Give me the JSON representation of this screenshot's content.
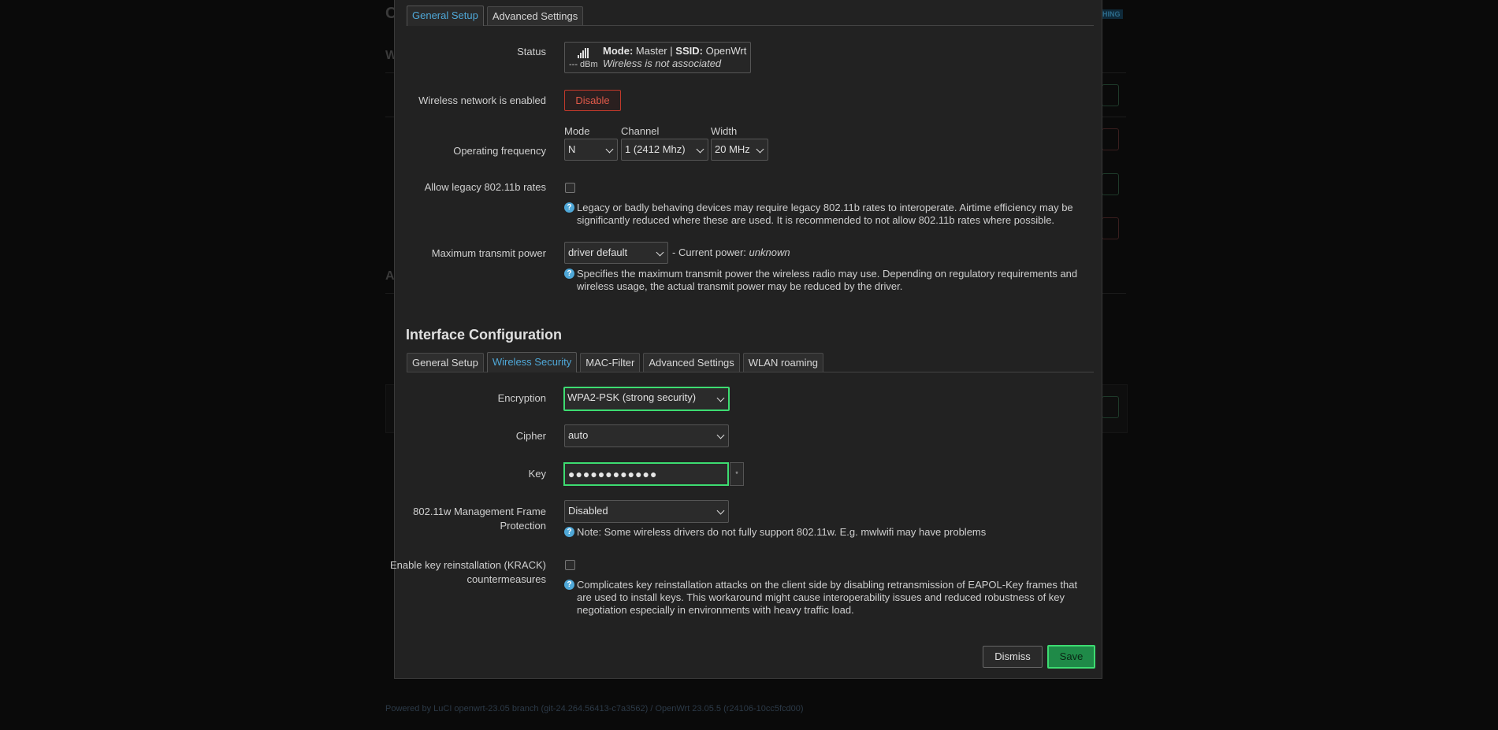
{
  "background": {
    "footer": "Powered by LuCI openwrt-23.05 branch (git-24.264.56413-c7a3562) / OpenWrt 23.05.5 (r24106-10cc5fcd00)",
    "badge": "HING",
    "fragments": [
      "C",
      "W",
      "A"
    ]
  },
  "device_tabs": [
    {
      "label": "General Setup",
      "active": true
    },
    {
      "label": "Advanced Settings",
      "active": false
    }
  ],
  "status": {
    "label": "Status",
    "mode_key": "Mode:",
    "mode_value": "Master",
    "separator": "|",
    "ssid_key": "SSID:",
    "ssid_value": "OpenWrt",
    "dbm": "--- dBm",
    "assoc": "Wireless is not associated"
  },
  "enabled": {
    "label": "Wireless network is enabled",
    "button": "Disable"
  },
  "frequency": {
    "label": "Operating frequency",
    "mode_label": "Mode",
    "mode_value": "N",
    "channel_label": "Channel",
    "channel_value": "1 (2412 Mhz)",
    "width_label": "Width",
    "width_value": "20 MHz"
  },
  "legacy": {
    "label": "Allow legacy 802.11b rates",
    "help": "Legacy or badly behaving devices may require legacy 802.11b rates to interoperate. Airtime efficiency may be significantly reduced where these are used. It is recommended to not allow 802.11b rates where possible."
  },
  "txpower": {
    "label": "Maximum transmit power",
    "value": "driver default",
    "current_prefix": "- Current power:",
    "current_value": "unknown",
    "help": "Specifies the maximum transmit power the wireless radio may use. Depending on regulatory requirements and wireless usage, the actual transmit power may be reduced by the driver."
  },
  "iface_title": "Interface Configuration",
  "iface_tabs": [
    {
      "label": "General Setup",
      "active": false
    },
    {
      "label": "Wireless Security",
      "active": true
    },
    {
      "label": "MAC-Filter",
      "active": false
    },
    {
      "label": "Advanced Settings",
      "active": false
    },
    {
      "label": "WLAN roaming",
      "active": false
    }
  ],
  "encryption": {
    "label": "Encryption",
    "value": "WPA2-PSK (strong security)"
  },
  "cipher": {
    "label": "Cipher",
    "value": "auto"
  },
  "key": {
    "label": "Key",
    "value": "●●●●●●●●●●●●",
    "reveal": "*"
  },
  "mfp": {
    "label": "802.11w Management Frame Protection",
    "value": "Disabled",
    "help": "Note: Some wireless drivers do not fully support 802.11w. E.g. mwlwifi may have problems"
  },
  "krack": {
    "label": "Enable key reinstallation (KRACK) countermeasures",
    "help": "Complicates key reinstallation attacks on the client side by disabling retransmission of EAPOL-Key frames that are used to install keys. This workaround might cause interoperability issues and reduced robustness of key negotiation especially in environments with heavy traffic load."
  },
  "buttons": {
    "dismiss": "Dismiss",
    "save": "Save"
  },
  "colors": {
    "accent": "#4fa8d8",
    "focus": "#3ddc71",
    "danger": "#c0392b",
    "save_bg": "#1f8a48"
  }
}
